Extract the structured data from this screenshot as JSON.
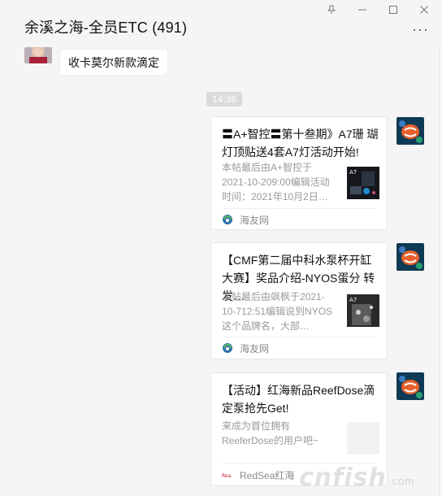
{
  "chat": {
    "title": "余溪之海-全员ETC (491)"
  },
  "window": {
    "pin_icon": "pin-icon",
    "minimize_icon": "minimize-icon",
    "maximize_icon": "maximize-icon",
    "close_icon": "close-icon",
    "more_label": "···"
  },
  "messages": {
    "first": {
      "text": "收卡莫尔新款滴定"
    },
    "time": "14:36",
    "cards": [
      {
        "title": "〓A+智控〓第十叁期》A7珊 瑚灯顶贴送4套A7灯活动开始!",
        "desc": "本帖最后由A+智控于2021-10-209:00编辑活动时间：2021年10月2日…",
        "source": "海友网"
      },
      {
        "title": "【CMF第二届中科水泵杯开缸大赛】奖品介绍-NYOS蛋分 转发…",
        "desc": "本帖最后由飒枫于2021-10-712:51编辑说到NYOS这个品牌名，大部…",
        "source": "海友网"
      },
      {
        "title": "【活动】红海新品ReefDose滴定泵抢先Get!",
        "desc": "来成为首位拥有ReeferDose的用户吧~",
        "source": "RedSea红海"
      }
    ]
  },
  "watermark": {
    "text": "cnfish",
    "tail": ".com"
  },
  "colors": {
    "background": "#f5f5f5",
    "bubble": "#ffffff",
    "time_badge": "#dadada",
    "link_source_icon": "#2f8f3a"
  }
}
